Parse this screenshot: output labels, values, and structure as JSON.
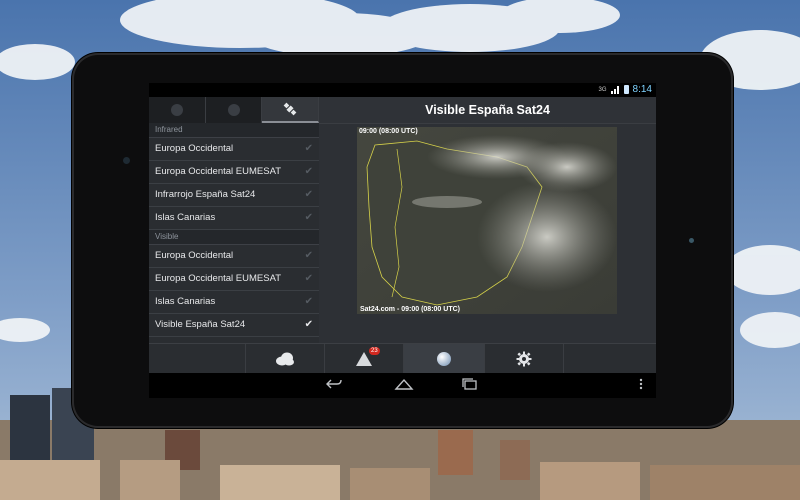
{
  "status_bar": {
    "signal": "3G",
    "time": "8:14"
  },
  "left_panel": {
    "tabs": [
      {
        "icon": "globe-infrared-icon"
      },
      {
        "icon": "globe-visible-icon"
      },
      {
        "icon": "satellite-icon",
        "active": true
      }
    ],
    "sections": [
      {
        "header": "Infrared",
        "items": [
          "Europa Occidental",
          "Europa Occidental EUMESAT",
          "Infrarrojo España Sat24",
          "Islas Canarias"
        ]
      },
      {
        "header": "Visible",
        "items": [
          "Europa Occidental",
          "Europa Occidental EUMESAT",
          "Islas Canarias",
          "Visible España Sat24"
        ]
      }
    ],
    "selected_item": "Visible España Sat24"
  },
  "main": {
    "title": "Visible España Sat24",
    "image_top_label": "09:00 (08:00 UTC)",
    "image_bottom_label": "Sat24.com - 09:00 (08:00 UTC)"
  },
  "bottom_bar": [
    {
      "icon": "cloud-icon"
    },
    {
      "icon": "warning-icon",
      "badge": "23"
    },
    {
      "icon": "globe-icon",
      "active": true
    },
    {
      "icon": "gear-icon"
    }
  ],
  "nav_bar": [
    "back-icon",
    "home-icon",
    "recent-apps-icon",
    "overflow-menu-icon"
  ],
  "colors": {
    "status_time": "#7fd3ff",
    "badge": "#d2281f",
    "panel_bg": "#2a2d31"
  }
}
